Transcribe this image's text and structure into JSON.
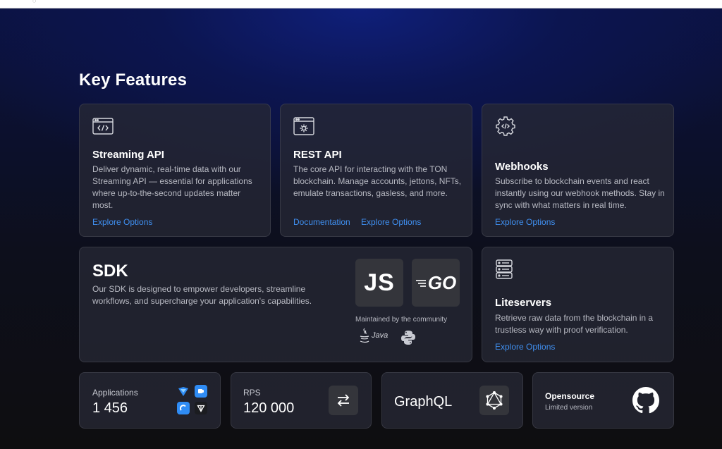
{
  "page": {
    "title": "Key Features"
  },
  "features": {
    "streaming": {
      "title": "Streaming API",
      "description": "Deliver dynamic, real-time data with our Streaming API — essential for applications where up-to-the-second updates matter most.",
      "link": "Explore Options",
      "icon": "code-window-icon"
    },
    "rest": {
      "title": "REST API",
      "description": "The core API for interacting with the TON blockchain. Manage accounts, jettons, NFTs, emulate transactions, gasless, and more.",
      "link_docs": "Documentation",
      "link": "Explore Options",
      "icon": "settings-window-icon"
    },
    "webhooks": {
      "title": "Webhooks",
      "description": "Subscribe to blockchain events and react instantly using our webhook methods. Stay in sync with what matters in real time.",
      "link": "Explore Options",
      "icon": "code-gear-icon"
    },
    "sdk": {
      "title": "SDK",
      "description": "Our SDK is designed to empower developers, streamline workflows, and supercharge your application's capabilities.",
      "js_label": "JS",
      "go_label": "GO",
      "community_label": "Maintained by the community",
      "java_label": "Java"
    },
    "liteservers": {
      "title": "Liteservers",
      "description": "Retrieve raw data from the blockchain in a trustless way with proof verification.",
      "link": "Explore Options",
      "icon": "server-icon"
    }
  },
  "stats": {
    "applications": {
      "label": "Applications",
      "value": "1 456"
    },
    "rps": {
      "label": "RPS",
      "value": "120 000"
    },
    "graphql": {
      "label": "GraphQL"
    },
    "opensource": {
      "label": "Opensource",
      "sub": "Limited version"
    }
  },
  "colors": {
    "link": "#3f8ff0",
    "card": "#262834",
    "accent_blue": "#2f8cf5"
  }
}
